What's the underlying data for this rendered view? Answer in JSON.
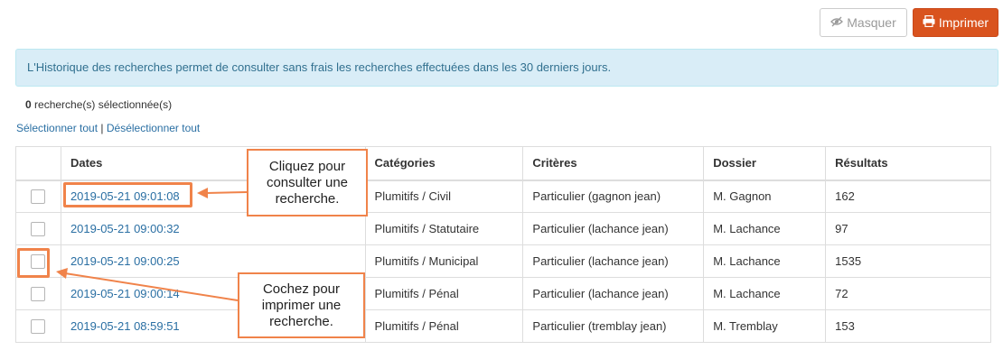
{
  "toolbar": {
    "hide_label": "Masquer",
    "print_label": "Imprimer"
  },
  "info_message": "L'Historique des recherches permet de consulter sans frais les recherches effectuées dans les 30 derniers jours.",
  "selection": {
    "count": "0",
    "count_suffix": "recherche(s) sélectionnée(s)",
    "select_all": "Sélectionner tout",
    "separator": "|",
    "deselect_all": "Désélectionner tout"
  },
  "table": {
    "columns": [
      "",
      "Dates",
      "Catégories",
      "Critères",
      "Dossier",
      "Résultats"
    ],
    "rows": [
      {
        "date": "2019-05-21 09:01:08",
        "category": "Plumitifs / Civil",
        "criteria": "Particulier (gagnon jean)",
        "file": "M. Gagnon",
        "results": "162"
      },
      {
        "date": "2019-05-21 09:00:32",
        "category": "Plumitifs / Statutaire",
        "criteria": "Particulier (lachance jean)",
        "file": "M. Lachance",
        "results": "97"
      },
      {
        "date": "2019-05-21 09:00:25",
        "category": "Plumitifs / Municipal",
        "criteria": "Particulier (lachance jean)",
        "file": "M. Lachance",
        "results": "1535"
      },
      {
        "date": "2019-05-21 09:00:14",
        "category": "Plumitifs / Pénal",
        "criteria": "Particulier (lachance jean)",
        "file": "M. Lachance",
        "results": "72"
      },
      {
        "date": "2019-05-21 08:59:51",
        "category": "Plumitifs / Pénal",
        "criteria": "Particulier (tremblay jean)",
        "file": "M. Tremblay",
        "results": "153"
      }
    ]
  },
  "annotations": {
    "consult": [
      "Cliquez pour",
      "consulter une",
      "recherche."
    ],
    "print": [
      "Cochez pour",
      "imprimer une",
      "recherche."
    ]
  },
  "colors": {
    "print_button": "#d9531e",
    "alert_bg": "#d9edf7",
    "link": "#2a6fa3",
    "annotation": "#f0834a"
  }
}
